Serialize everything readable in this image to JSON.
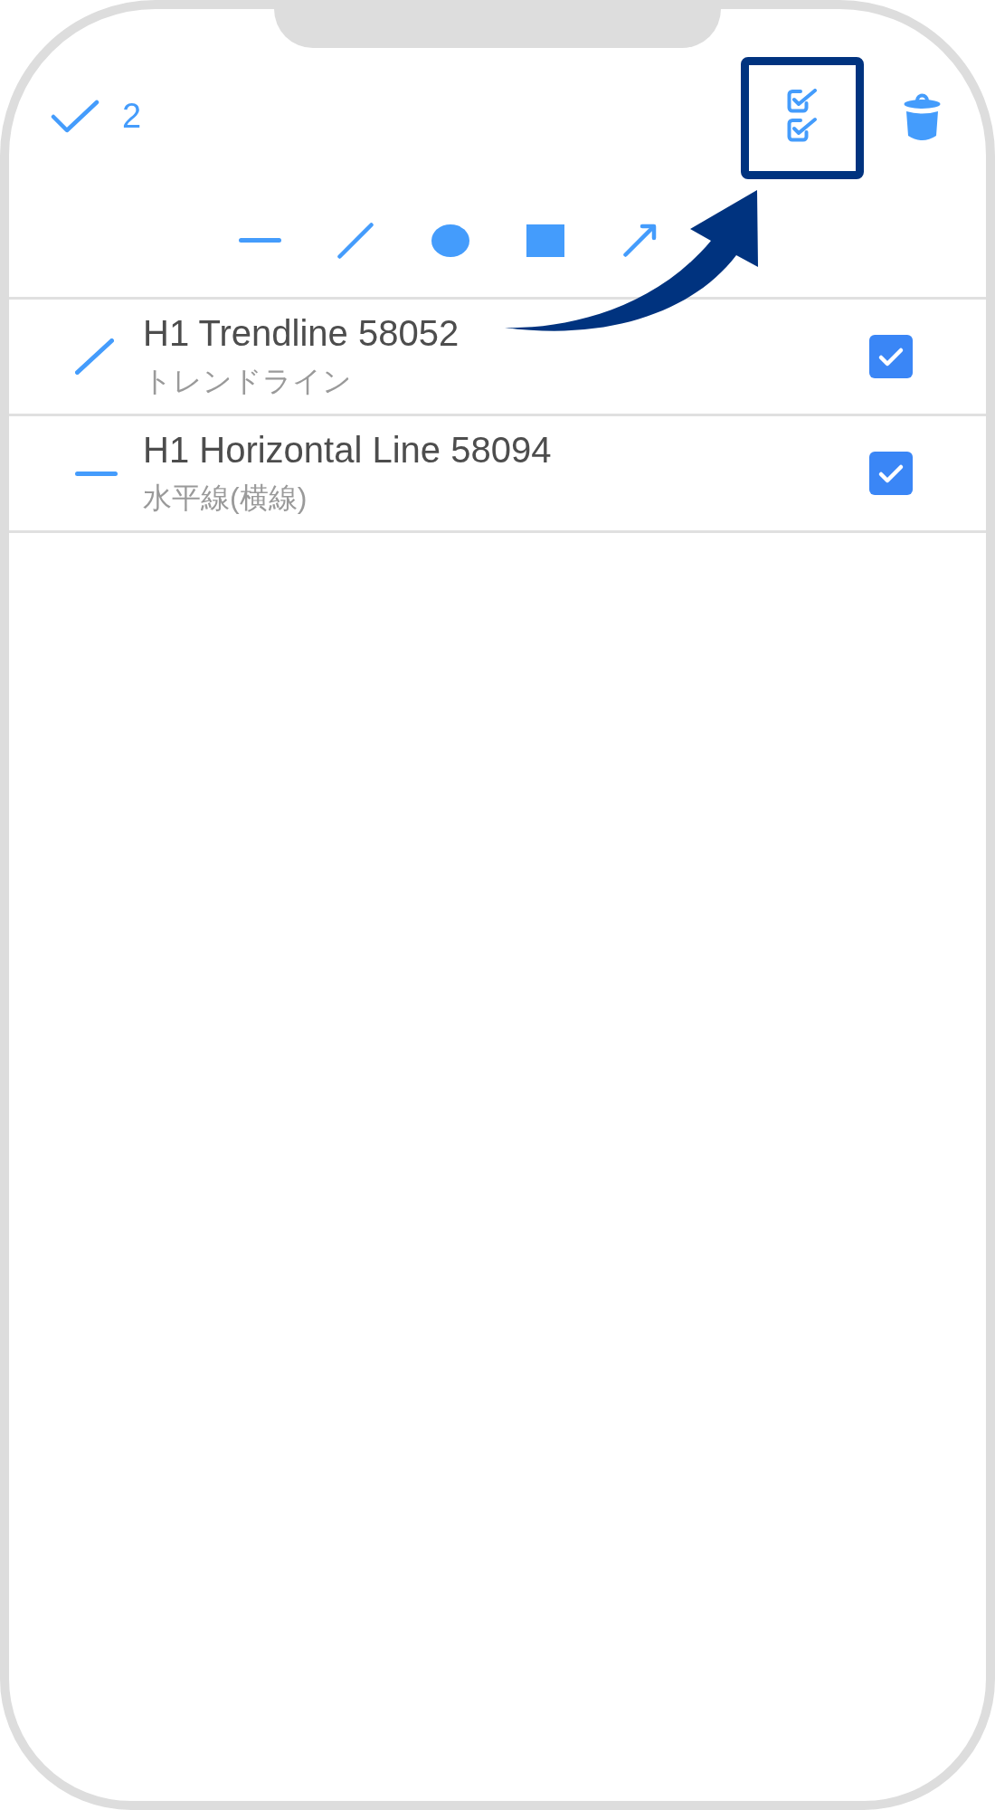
{
  "header": {
    "count": "2"
  },
  "tools": [
    {
      "kind": "horizontal_line"
    },
    {
      "kind": "trendline"
    },
    {
      "kind": "ellipse"
    },
    {
      "kind": "rectangle"
    },
    {
      "kind": "arrow"
    }
  ],
  "objects": [
    {
      "kind": "trendline",
      "name": "H1 Trendline 58052",
      "type": "トレンドライン",
      "checked": true
    },
    {
      "kind": "horizontal_line",
      "name": "H1 Horizontal Line 58094",
      "type": "水平線(横線)",
      "checked": true
    }
  ]
}
